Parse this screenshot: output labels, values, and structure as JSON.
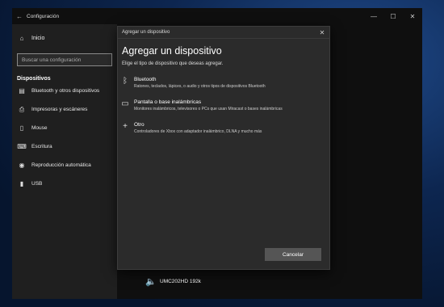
{
  "window": {
    "title": "Configuración",
    "back_icon": "←",
    "minimize": "—",
    "maximize": "☐",
    "close": "✕"
  },
  "sidebar": {
    "home": "Inicio",
    "search_placeholder": "Buscar una configuración",
    "section_title": "Dispositivos",
    "items": [
      {
        "label": "Bluetooth y otros dispositivos",
        "icon": "bluetooth-devices-icon"
      },
      {
        "label": "Impresoras y escáneres",
        "icon": "printer-icon"
      },
      {
        "label": "Mouse",
        "icon": "mouse-icon"
      },
      {
        "label": "Escritura",
        "icon": "keyboard-icon"
      },
      {
        "label": "Reproducción automática",
        "icon": "autoplay-icon"
      },
      {
        "label": "USB",
        "icon": "usb-icon"
      }
    ]
  },
  "dialog": {
    "title": "Agregar un dispositivo",
    "heading": "Agregar un dispositivo",
    "subtitle": "Elige el tipo de dispositivo que deseas agregar.",
    "options": [
      {
        "title": "Bluetooth",
        "desc": "Ratones, teclados, lápices, o audio y otros tipos de dispositivos Bluetooth",
        "icon": "bluetooth-icon"
      },
      {
        "title": "Pantalla o base inalámbricas",
        "desc": "Monitores inalámbricos, televisores o PCs que usan Miracast o bases inalámbricas",
        "icon": "monitor-icon"
      },
      {
        "title": "Otro",
        "desc": "Controladores de Xbox con adaptador inalámbrico, DLNA y mucho más",
        "icon": "plus-icon"
      }
    ],
    "cancel": "Cancelar"
  },
  "background_device": {
    "label": "UMC202HD 192k",
    "icon": "speaker-icon"
  },
  "colors": {
    "sidebar_bg": "#1f1f1f",
    "dialog_bg": "#2b2b2b",
    "button_bg": "#555555"
  }
}
